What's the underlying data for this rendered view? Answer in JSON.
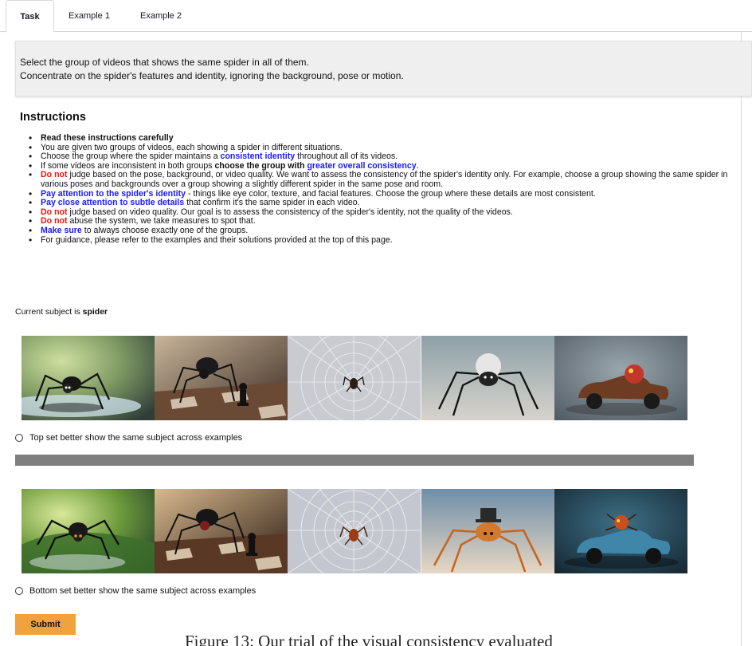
{
  "tabs": [
    "Task",
    "Example 1",
    "Example 2"
  ],
  "prompt": {
    "line1": "Select the group of videos that shows the same spider in all of them.",
    "line2": "Concentrate on the spider's features and identity, ignoring the background, pose or motion."
  },
  "instructions": {
    "title": "Instructions",
    "items": [
      {
        "parts": [
          {
            "t": "Read these instructions carefully",
            "s": "bold"
          }
        ]
      },
      {
        "parts": [
          {
            "t": "You are given two groups of videos, each showing a spider in different situations.",
            "s": ""
          }
        ]
      },
      {
        "parts": [
          {
            "t": "Choose the group where the spider maintains a ",
            "s": ""
          },
          {
            "t": "consistent identity",
            "s": "blue"
          },
          {
            "t": " throughout all of its videos.",
            "s": ""
          }
        ]
      },
      {
        "parts": [
          {
            "t": "If some videos are inconsistent in both groups ",
            "s": ""
          },
          {
            "t": "choose the group with ",
            "s": "bold"
          },
          {
            "t": "greater overall consistency",
            "s": "blue"
          },
          {
            "t": ".",
            "s": ""
          }
        ]
      },
      {
        "parts": [
          {
            "t": "Do not",
            "s": "red"
          },
          {
            "t": " judge based on the pose, background, or video quality. We want to assess the consistency of the spider's identity only. For example, choose a group showing the same spider in various poses and backgrounds over a group showing a slightly different spider in the same pose and room.",
            "s": ""
          }
        ]
      },
      {
        "parts": [
          {
            "t": "Pay attention to the spider's identity",
            "s": "blue"
          },
          {
            "t": " - things like eye color, texture, and facial features. Choose the group where these details are most consistent.",
            "s": ""
          }
        ]
      },
      {
        "parts": [
          {
            "t": "Pay close attention to subtle details",
            "s": "blue"
          },
          {
            "t": " that confirm it's the same spider in each video.",
            "s": ""
          }
        ]
      },
      {
        "parts": [
          {
            "t": "Do not",
            "s": "red"
          },
          {
            "t": " judge based on video quality. Our goal is to assess the consistency of the spider's identity, not the quality of the videos.",
            "s": ""
          }
        ]
      },
      {
        "parts": [
          {
            "t": "Do not",
            "s": "red"
          },
          {
            "t": " abuse the system, we take measures to spot that.",
            "s": ""
          }
        ]
      },
      {
        "parts": [
          {
            "t": "Make sure",
            "s": "blue"
          },
          {
            "t": " to always choose exactly one of the groups.",
            "s": ""
          }
        ]
      },
      {
        "parts": [
          {
            "t": "For guidance, please refer to the examples and their solutions provided at the top of this page.",
            "s": ""
          }
        ]
      }
    ]
  },
  "subject": {
    "prefix": "Current subject is ",
    "name": "spider"
  },
  "options": {
    "top": "Top set better show the same subject across examples",
    "bottom": "Bottom set better show the same subject across examples"
  },
  "submit_label": "Submit",
  "caption": "Figure 13: Our trial of the visual consistency evaluated",
  "colors": {
    "submit": "#f0a33c",
    "blue_emphasis": "#1a1aff",
    "red_emphasis": "#e8160c",
    "separator": "#7f7f7f"
  },
  "thumbnails": {
    "top": [
      "spider-on-leaf",
      "spider-on-chessboard",
      "spider-in-web",
      "spider-white-backdrop",
      "spider-car"
    ],
    "bottom": [
      "spider-on-leaf",
      "spider-on-chessboard",
      "spider-in-web",
      "spider-with-top-hat",
      "spider-car"
    ]
  }
}
